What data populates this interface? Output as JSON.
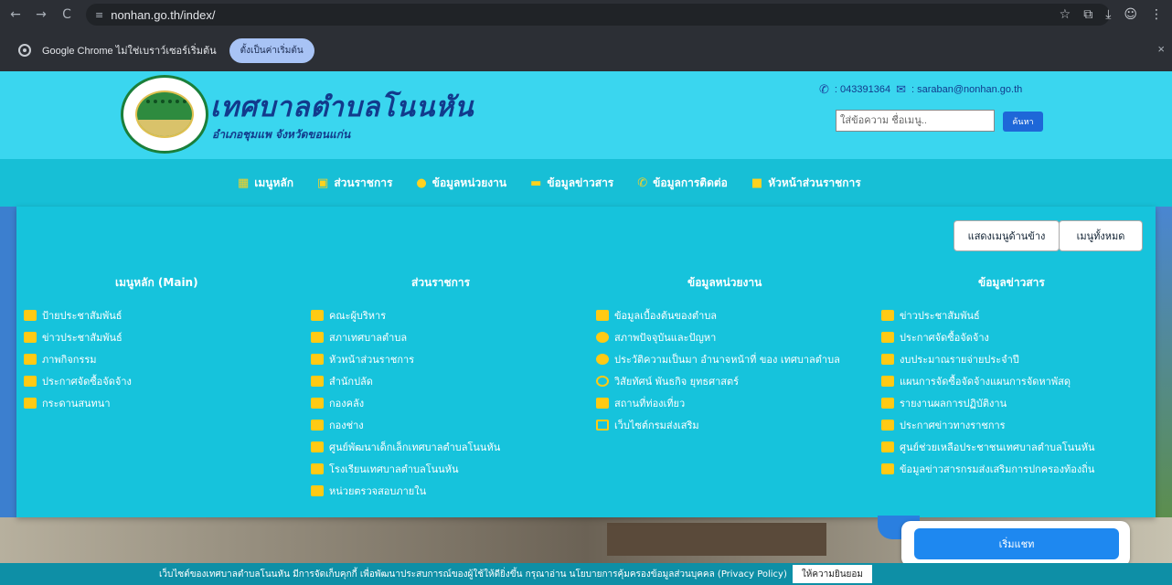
{
  "browser": {
    "back_icon": "←",
    "forward_icon": "→",
    "reload_icon": "C",
    "tune_icon": "≡",
    "url": "nonhan.go.th/index/",
    "right_icons": [
      "☆",
      "⧉",
      "⤓",
      "☺",
      "⋮"
    ]
  },
  "info_bar": {
    "message": "Google Chrome ไม่ใช่เบราว์เซอร์เริ่มต้น",
    "default_button": "ตั้งเป็นค่าเริ่มต้น",
    "close_icon": "×"
  },
  "header": {
    "title": "เทศบาลตำบลโนนหัน",
    "subtitle": "อำเภอชุมแพ จังหวัดขอนแก่น",
    "phone": ": 043391364",
    "email": ": saraban@nonhan.go.th",
    "phone_icon": "✆",
    "email_icon": "✉",
    "search_placeholder": "ใส่ข้อความ ชื่อเมนู..",
    "search_button": "ค้นหา"
  },
  "nav": [
    {
      "icon": "▦",
      "label": "เมนูหลัก"
    },
    {
      "icon": "▣",
      "label": "ส่วนราชการ"
    },
    {
      "icon": "●",
      "label": "ข้อมูลหน่วยงาน"
    },
    {
      "icon": "▬",
      "label": "ข้อมูลข่าวสาร"
    },
    {
      "icon": "✆",
      "label": "ข้อมูลการติดต่อ"
    },
    {
      "icon": "■",
      "label": "หัวหน้าส่วนราชการ"
    }
  ],
  "mega_menu": {
    "side_menu_button": "แสดงเมนูด้านข้าง",
    "all_menu_button": "เมนูทั้งหมด",
    "columns": [
      {
        "title": "เมนูหลัก (Main)",
        "items": [
          "ป้ายประชาสัมพันธ์",
          "ข่าวประชาสัมพันธ์",
          "ภาพกิจกรรม",
          "ประกาศจัดซื้อจัดจ้าง",
          "กระดานสนทนา"
        ]
      },
      {
        "title": "ส่วนราชการ",
        "items": [
          "คณะผู้บริหาร",
          "สภาเทศบาลตำบล",
          "หัวหน้าส่วนราชการ",
          "สำนักปลัด",
          "กองคลัง",
          "กองช่าง",
          "ศูนย์พัฒนาเด็กเล็กเทศบาลตำบลโนนหัน",
          "โรงเรียนเทศบาลตำบลโนนหัน",
          "หน่วยตรวจสอบภายใน"
        ]
      },
      {
        "title": "ข้อมูลหน่วยงาน",
        "items": [
          "ข้อมูลเบื้องต้นของตำบล",
          "สภาพปัจจุบันและปัญหา",
          "ประวัติความเป็นมา อำนาจหน้าที่ ของ เทศบาลตำบล",
          "วิสัยทัศน์ พันธกิจ ยุทธศาสตร์",
          "สถานที่ท่องเที่ยว",
          "เว็บไซต์กรมส่งเสริม"
        ]
      },
      {
        "title": "ข้อมูลข่าวสาร",
        "items": [
          "ข่าวประชาสัมพันธ์",
          "ประกาศจัดซื้อจัดจ้าง",
          "งบประมาณรายจ่ายประจำปี",
          "แผนการจัดซื้อจัดจ้างแผนการจัดหาพัสดุ",
          "รายงานผลการปฏิบัติงาน",
          "ประกาศข่าวทางราชการ",
          "ศูนย์ช่วยเหลือประชาชนเทศบาลตำบลโนนหัน",
          "ข้อมูลข่าวสารกรมส่งเสริมการปกครองท้องถิ่น"
        ]
      }
    ]
  },
  "chat": {
    "button": "เริ่มแชท"
  },
  "cookie": {
    "text": "เว็บไซต์ของเทศบาลตำบลโนนหัน มีการจัดเก็บคุกกี้ เพื่อพัฒนาประสบการณ์ของผู้ใช้ให้ดียิ่งขึ้น กรุณาอ่าน นโยบายการคุ้มครองข้อมูลส่วนบุคคล (Privacy Policy)",
    "accept_button": "ให้ความยินยอม"
  }
}
